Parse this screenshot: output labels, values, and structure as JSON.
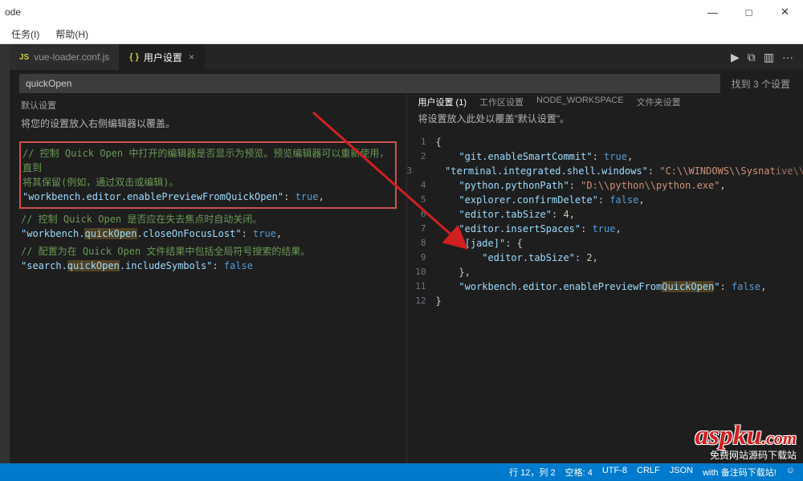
{
  "window": {
    "title": "ode"
  },
  "menubar": {
    "tasks": "任务(I)",
    "help": "帮助(H)"
  },
  "win_controls": {
    "min": "—",
    "max": "□",
    "close": "✕"
  },
  "tabs": {
    "file1": "vue-loader.conf.js",
    "file1_prefix": "JS",
    "file2_prefix": "{ }",
    "file2": "用户设置",
    "close": "×"
  },
  "tab_actions": {
    "run": "▶",
    "split": "⧉",
    "layout": "▥",
    "more": "···"
  },
  "search": {
    "value": "quickOpen",
    "result": "找到 3 个设置"
  },
  "left_pane": {
    "title": "默认设置",
    "subtitle": "将您的设置放入右侧编辑器以覆盖。",
    "block1_comment1": "// 控制 Quick Open 中打开的编辑器是否显示为预览。预览编辑器可以重新使用，直到",
    "block1_comment2": "将其保留(例如，通过双击或编辑)。",
    "block1_key": "\"workbench.editor.enablePreviewFromQuickOpen\"",
    "block1_val": "true",
    "block2_comment": "// 控制 Quick Open 是否应在失去焦点时自动关闭。",
    "block2_key": "\"workbench.",
    "block2_key_hl": "quickOpen",
    "block2_key_rest": ".closeOnFocusLost\"",
    "block2_val": "true",
    "block3_comment": "// 配置为在 Quick Open 文件结果中包括全局符号搜索的结果。",
    "block3_key": "\"search.",
    "block3_key_hl": "quickOpen",
    "block3_key_rest": ".includeSymbols\"",
    "block3_val": "false"
  },
  "right_pane": {
    "tab_user": "用户设置 (1)",
    "tab_workspace": "工作区设置",
    "tab_node": "NODE_WORKSPACE",
    "tab_folder": "文件夹设置",
    "subtitle": "将设置放入此处以覆盖\"默认设置\"。",
    "lines": [
      {
        "n": "1",
        "t": "{"
      },
      {
        "n": "2",
        "k": "\"git.enableSmartCommit\"",
        "v": "true",
        "vt": "bool"
      },
      {
        "n": "3",
        "k": "\"terminal.integrated.shell.windows\"",
        "v": "\"C:\\\\WINDOWS\\\\Sysnative\\\\",
        "vt": "str"
      },
      {
        "n": "4",
        "k": "\"python.pythonPath\"",
        "v": "\"D:\\\\python\\\\python.exe\"",
        "vt": "str"
      },
      {
        "n": "5",
        "k": "\"explorer.confirmDelete\"",
        "v": "false",
        "vt": "bool"
      },
      {
        "n": "6",
        "k": "\"editor.tabSize\"",
        "v": "4",
        "vt": "num"
      },
      {
        "n": "7",
        "k": "\"editor.insertSpaces\"",
        "v": "true",
        "vt": "bool"
      },
      {
        "n": "8",
        "k": "\"[jade]\"",
        "v": "{",
        "vt": "punct"
      },
      {
        "n": "9",
        "k": "\"editor.tabSize\"",
        "v": "2",
        "vt": "num",
        "indent": true
      },
      {
        "n": "10",
        "t": "    },"
      },
      {
        "n": "11",
        "k": "\"workbench.editor.enablePreviewFrom",
        "khl": "QuickOpen",
        "krest": "\"",
        "v": "false",
        "vt": "bool"
      },
      {
        "n": "12",
        "t": "}"
      }
    ]
  },
  "statusbar": {
    "ln_col": "行 12，列 2",
    "spaces": "空格: 4",
    "encoding": "UTF-8",
    "eol": "CRLF",
    "lang": "JSON",
    "rest": "with 备注码下载站!",
    "face": "☺"
  },
  "watermark": {
    "main": "aspku",
    "suffix": ".com",
    "sub": "免费网站源码下载站"
  }
}
